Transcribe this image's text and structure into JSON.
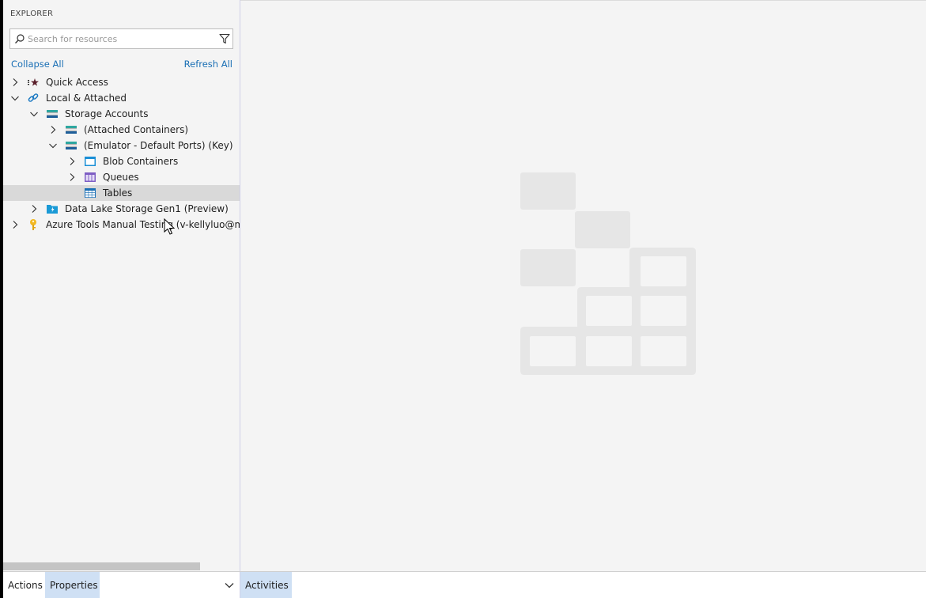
{
  "explorer": {
    "title": "EXPLORER",
    "search_placeholder": "Search for resources",
    "collapse_all": "Collapse All",
    "refresh_all": "Refresh All"
  },
  "tree": {
    "quick_access": "Quick Access",
    "local_attached": "Local & Attached",
    "storage_accounts": "Storage Accounts",
    "attached_containers": "(Attached Containers)",
    "emulator": "(Emulator - Default Ports) (Key)",
    "blob_containers": "Blob Containers",
    "queues": "Queues",
    "tables": "Tables",
    "data_lake": "Data Lake Storage Gen1 (Preview)",
    "azure_tools": "Azure Tools Manual Testing (v-kellyluo@microsoft.com)"
  },
  "bottom": {
    "actions": "Actions",
    "properties": "Properties",
    "activities": "Activities"
  },
  "icons": {
    "search": "search-icon",
    "filter": "filter-icon",
    "chevron_right": "chevron-right-icon",
    "chevron_down": "chevron-down-icon",
    "quick_access": "quick-access-icon",
    "link": "link-icon",
    "storage": "storage-account-icon",
    "blob": "blob-container-icon",
    "queue": "queue-icon",
    "table": "table-icon",
    "data_lake": "data-lake-icon",
    "key": "subscription-key-icon"
  },
  "colors": {
    "link_blue": "#1a6fb5",
    "selected_row": "#d9d9d9",
    "active_tab": "#cfe0f4"
  }
}
